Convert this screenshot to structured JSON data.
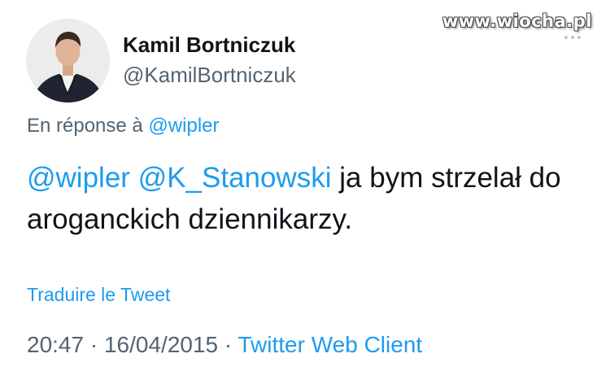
{
  "watermark": "www.wiocha.pl",
  "author": {
    "display_name": "Kamil Bortniczuk",
    "handle": "@KamilBortniczuk"
  },
  "reply": {
    "prefix": "En réponse à",
    "to": "@wipler"
  },
  "tweet": {
    "mention_1": "@wipler",
    "mention_2": "@K_Stanowski",
    "text": "ja bym strzelał do aroganckich dziennikarzy."
  },
  "translate_label": "Traduire le Tweet",
  "meta": {
    "time": "20:47",
    "date": "16/04/2015",
    "separator": "·",
    "client": "Twitter Web Client"
  },
  "icons": {
    "more": "more-horizontal-icon"
  },
  "colors": {
    "link": "#1d9bf0",
    "primary_text": "#0f1419",
    "secondary_text": "#536471"
  }
}
